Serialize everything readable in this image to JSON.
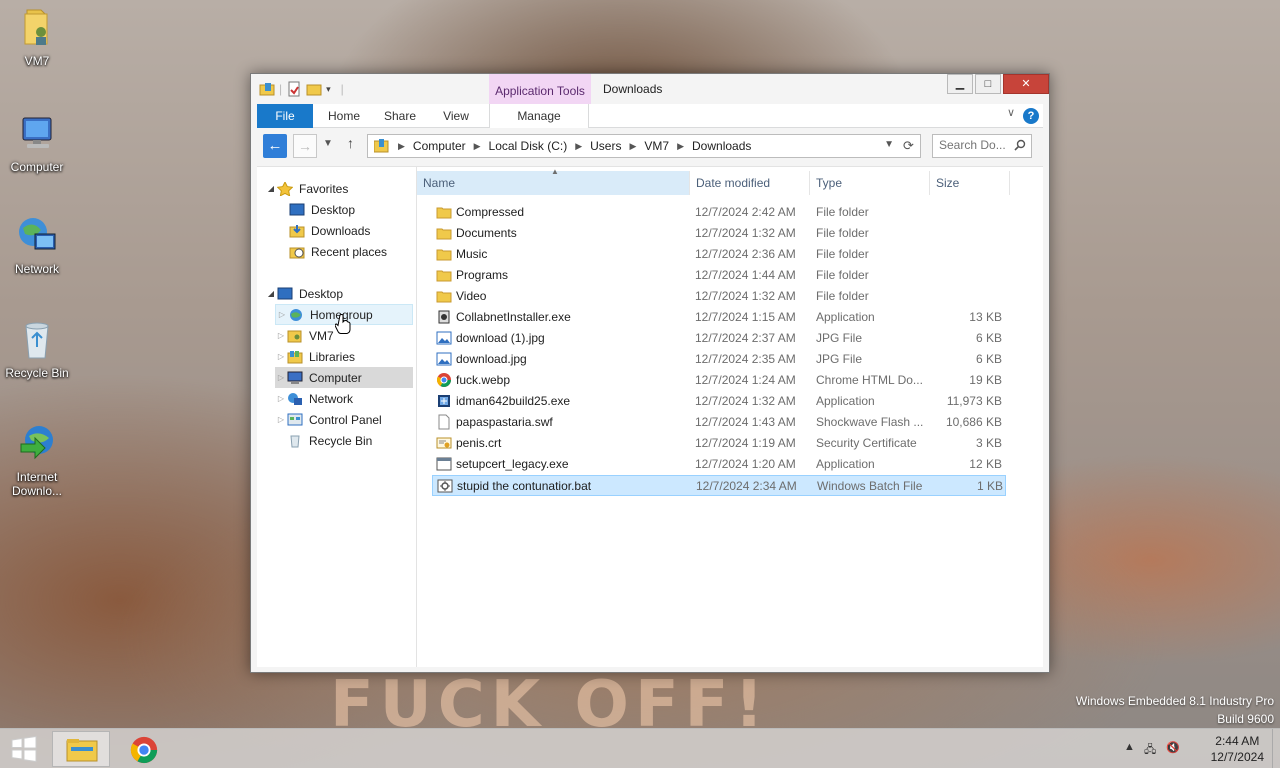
{
  "desktop": {
    "background_caption": "FUCK OFF!",
    "icons": [
      {
        "label": "VM7",
        "icon": "user-folder-icon"
      },
      {
        "label": "Computer",
        "icon": "computer-icon"
      },
      {
        "label": "Network",
        "icon": "network-icon"
      },
      {
        "label": "Recycle Bin",
        "icon": "recycle-bin-icon"
      },
      {
        "label": "Internet Downlo...",
        "icon": "internet-download-manager-icon"
      }
    ],
    "watermark_line1": "Windows Embedded 8.1 Industry Pro",
    "watermark_line2": "Build 9600"
  },
  "window": {
    "title": "Downloads",
    "context_tab": "Application Tools",
    "ribbon_tabs": {
      "file": "File",
      "home": "Home",
      "share": "Share",
      "view": "View",
      "manage": "Manage"
    },
    "address": {
      "crumbs": [
        "Computer",
        "Local Disk (C:)",
        "Users",
        "VM7",
        "Downloads"
      ]
    },
    "search": {
      "placeholder": "Search Do..."
    },
    "nav_pane": {
      "favorites_label": "Favorites",
      "favorites": [
        "Desktop",
        "Downloads",
        "Recent places"
      ],
      "desktop_label": "Desktop",
      "desktop_children": [
        "Homegroup",
        "VM7",
        "Libraries",
        "Computer",
        "Network",
        "Control Panel",
        "Recycle Bin"
      ]
    },
    "columns": {
      "name": "Name",
      "date": "Date modified",
      "type": "Type",
      "size": "Size"
    },
    "files": [
      {
        "name": "Compressed",
        "date": "12/7/2024 2:42 AM",
        "type": "File folder",
        "size": "",
        "icon": "folder-icon"
      },
      {
        "name": "Documents",
        "date": "12/7/2024 1:32 AM",
        "type": "File folder",
        "size": "",
        "icon": "folder-icon"
      },
      {
        "name": "Music",
        "date": "12/7/2024 2:36 AM",
        "type": "File folder",
        "size": "",
        "icon": "folder-icon"
      },
      {
        "name": "Programs",
        "date": "12/7/2024 1:44 AM",
        "type": "File folder",
        "size": "",
        "icon": "folder-icon"
      },
      {
        "name": "Video",
        "date": "12/7/2024 1:32 AM",
        "type": "File folder",
        "size": "",
        "icon": "folder-icon"
      },
      {
        "name": "CollabnetInstaller.exe",
        "date": "12/7/2024 1:15 AM",
        "type": "Application",
        "size": "13 KB",
        "icon": "installer-icon"
      },
      {
        "name": "download (1).jpg",
        "date": "12/7/2024 2:37 AM",
        "type": "JPG File",
        "size": "6 KB",
        "icon": "image-icon"
      },
      {
        "name": "download.jpg",
        "date": "12/7/2024 2:35 AM",
        "type": "JPG File",
        "size": "6 KB",
        "icon": "image-icon"
      },
      {
        "name": "fuck.webp",
        "date": "12/7/2024 1:24 AM",
        "type": "Chrome HTML Do...",
        "size": "19 KB",
        "icon": "chrome-icon"
      },
      {
        "name": "idman642build25.exe",
        "date": "12/7/2024 1:32 AM",
        "type": "Application",
        "size": "11,973 KB",
        "icon": "setup-icon"
      },
      {
        "name": "papaspastaria.swf",
        "date": "12/7/2024 1:43 AM",
        "type": "Shockwave Flash ...",
        "size": "10,686 KB",
        "icon": "blank-file-icon"
      },
      {
        "name": "penis.crt",
        "date": "12/7/2024 1:19 AM",
        "type": "Security Certificate",
        "size": "3 KB",
        "icon": "certificate-icon"
      },
      {
        "name": "setupcert_legacy.exe",
        "date": "12/7/2024 1:20 AM",
        "type": "Application",
        "size": "12 KB",
        "icon": "application-icon"
      },
      {
        "name": "stupid the contunatior.bat",
        "date": "12/7/2024 2:34 AM",
        "type": "Windows Batch File",
        "size": "1 KB",
        "icon": "batch-file-icon"
      }
    ]
  },
  "taskbar": {
    "time": "2:44 AM",
    "date": "12/7/2024",
    "apps": [
      "file-explorer-icon",
      "chrome-icon"
    ]
  }
}
